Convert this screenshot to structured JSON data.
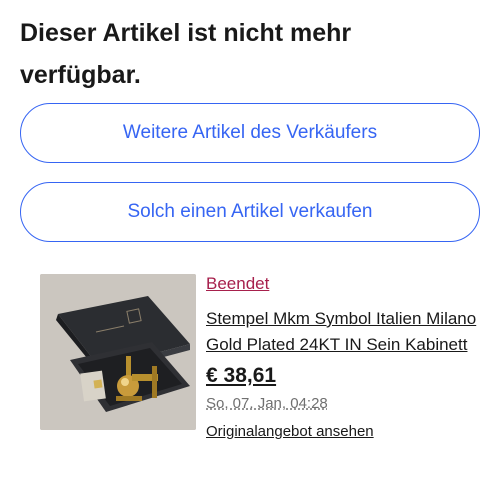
{
  "header": {
    "headline": "Dieser Artikel ist nicht mehr verfügbar."
  },
  "actions": {
    "more_from_seller": "Weitere Artikel des Verkäufers",
    "sell_similar": "Solch einen Artikel verkaufen"
  },
  "listing": {
    "status": "Beendet",
    "title": "Stempel Mkm Symbol Italien Milano Gold Plated 24KT IN Sein Kabinett",
    "price": "€ 38,61",
    "end_date": "So, 07. Jan, 04:28",
    "original_link": "Originalangebot ansehen",
    "image_alt": "product-photo"
  },
  "colors": {
    "accent": "#3665f3",
    "status": "#a7204c",
    "text": "#191919",
    "muted": "#707070"
  }
}
